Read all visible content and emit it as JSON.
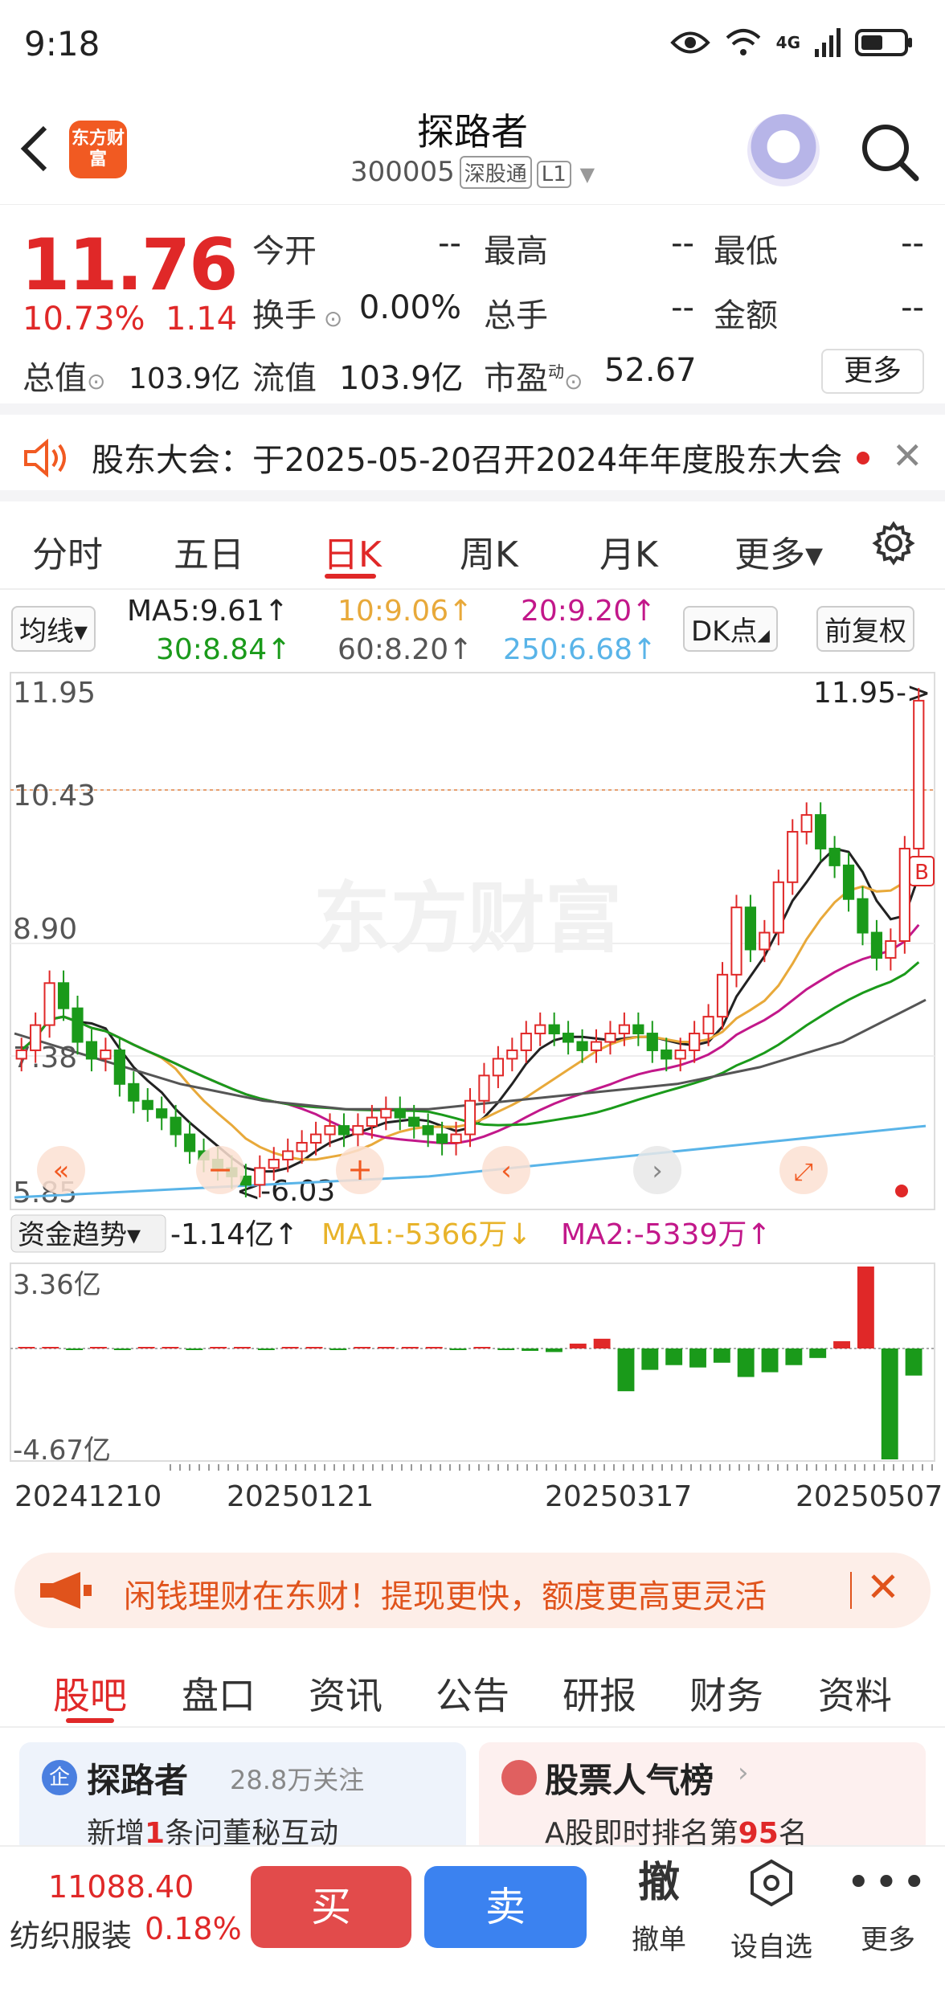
{
  "status_bar": {
    "time": "9:18",
    "network": "4G"
  },
  "header": {
    "back_icon": "chevron-left-icon",
    "brand_logo_text": "东方财富",
    "stock_name": "探路者",
    "stock_code": "300005",
    "exchange_tag": "深股通",
    "level_tag": "L1"
  },
  "quote": {
    "price": "11.76",
    "change_pct": "10.73%",
    "change_abs": "1.14",
    "fields": [
      {
        "label": "今开",
        "value": "--"
      },
      {
        "label": "最高",
        "value": "--"
      },
      {
        "label": "最低",
        "value": "--"
      },
      {
        "label": "换手",
        "value": "0.00%"
      },
      {
        "label": "总手",
        "value": "--"
      },
      {
        "label": "金额",
        "value": "--"
      }
    ],
    "total_mv_label": "总值",
    "total_mv": "103.9亿",
    "float_mv_label": "流值",
    "float_mv": "103.9亿",
    "pe_label": "市盈",
    "pe_superscript": "动",
    "pe": "52.67",
    "more_label": "更多"
  },
  "notice": {
    "text": "股东大会：于2025-05-20召开2024年年度股东大会"
  },
  "kline_tabs": [
    {
      "label": "分时",
      "active": false
    },
    {
      "label": "五日",
      "active": false
    },
    {
      "label": "日K",
      "active": true
    },
    {
      "label": "周K",
      "active": false
    },
    {
      "label": "月K",
      "active": false
    },
    {
      "label": "更多▾",
      "active": false
    }
  ],
  "ma_row": {
    "selector": "均线▾",
    "ma5": "MA5:9.61↑",
    "ma10": "10:9.06↑",
    "ma20": "20:9.20↑",
    "ma30": "30:8.84↑",
    "ma60": "60:8.20↑",
    "ma250": "250:6.68↑",
    "dk_label": "DK点",
    "adjust_label": "前复权",
    "colors": {
      "ma5": "#222222",
      "ma10": "#e8a93a",
      "ma20": "#c2188a",
      "ma30": "#1a9a1a",
      "ma60": "#555555",
      "ma250": "#59b4e8"
    }
  },
  "chart": {
    "watermark": "东方财富",
    "y_labels": [
      "11.95",
      "10.43",
      "8.90",
      "7.38",
      "5.85"
    ],
    "high_annotation": "11.95->",
    "low_annotation": "<-6.03",
    "fund_indicator": "资金趋势▾",
    "fund_value": "-1.14亿↑",
    "fund_ma1": "MA1:-5366万↓",
    "fund_ma2": "MA2:-5339万↑",
    "fund_y_labels": [
      "3.36亿",
      "-4.67亿"
    ],
    "dates": [
      "20241210",
      "20250121",
      "20250317",
      "20250507"
    ],
    "b_marker": "B"
  },
  "chart_data": {
    "type": "candlestick",
    "ylim": [
      5.85,
      11.95
    ],
    "closes": [
      7.6,
      7.9,
      8.4,
      8.1,
      7.7,
      7.5,
      7.6,
      7.2,
      7.0,
      6.9,
      6.8,
      6.6,
      6.4,
      6.3,
      6.2,
      6.1,
      6.0,
      6.2,
      6.3,
      6.4,
      6.5,
      6.6,
      6.7,
      6.6,
      6.7,
      6.8,
      6.9,
      6.8,
      6.7,
      6.6,
      6.5,
      6.6,
      7.0,
      7.3,
      7.5,
      7.6,
      7.8,
      7.9,
      7.8,
      7.7,
      7.6,
      7.7,
      7.8,
      7.9,
      7.8,
      7.6,
      7.5,
      7.6,
      7.8,
      8.0,
      8.5,
      9.3,
      8.8,
      9.0,
      9.6,
      10.2,
      10.4,
      10.0,
      9.8,
      9.4,
      9.0,
      8.7,
      8.9,
      10.0,
      11.76
    ],
    "fund_flow": [
      0.0,
      0.02,
      -0.01,
      0.01,
      -0.02,
      0.01,
      0.0,
      -0.03,
      0.02,
      0.01,
      -0.01,
      0.0,
      0.01,
      -0.02,
      0.03,
      0.05,
      0.03,
      0.02,
      -0.01,
      0.04,
      -0.05,
      -0.1,
      -0.15,
      0.2,
      0.4,
      -1.8,
      -0.9,
      -0.7,
      -0.8,
      -0.6,
      -1.2,
      -1.0,
      -0.7,
      -0.4,
      0.3,
      3.36,
      -4.67,
      -1.14
    ],
    "fund_ylim": [
      -4.67,
      3.36
    ]
  },
  "promo": {
    "text": "闲钱理财在东财！提现更快，额度更高更灵活"
  },
  "bottom_tabs": [
    {
      "label": "股吧",
      "active": true
    },
    {
      "label": "盘口",
      "active": false
    },
    {
      "label": "资讯",
      "active": false
    },
    {
      "label": "公告",
      "active": false
    },
    {
      "label": "研报",
      "active": false
    },
    {
      "label": "财务",
      "active": false
    },
    {
      "label": "资料",
      "active": false
    }
  ],
  "cards": {
    "left": {
      "badge": "企",
      "title": "探路者",
      "followers": "28.8万关注",
      "sub_pre": "新增",
      "sub_num": "1",
      "sub_post": "条问董秘互动"
    },
    "right": {
      "title": "股票人气榜",
      "sub_pre": "A股即时排名第",
      "sub_num": "95",
      "sub_post": "名"
    }
  },
  "bottom_bar": {
    "sector_value": "11088.40",
    "sector_name": "纺织服装",
    "sector_change": "0.18%",
    "buy_label": "买",
    "sell_label": "卖",
    "cancel_big": "撤",
    "cancel_label": "撤单",
    "watchlist_label": "设自选",
    "more_label": "更多"
  }
}
